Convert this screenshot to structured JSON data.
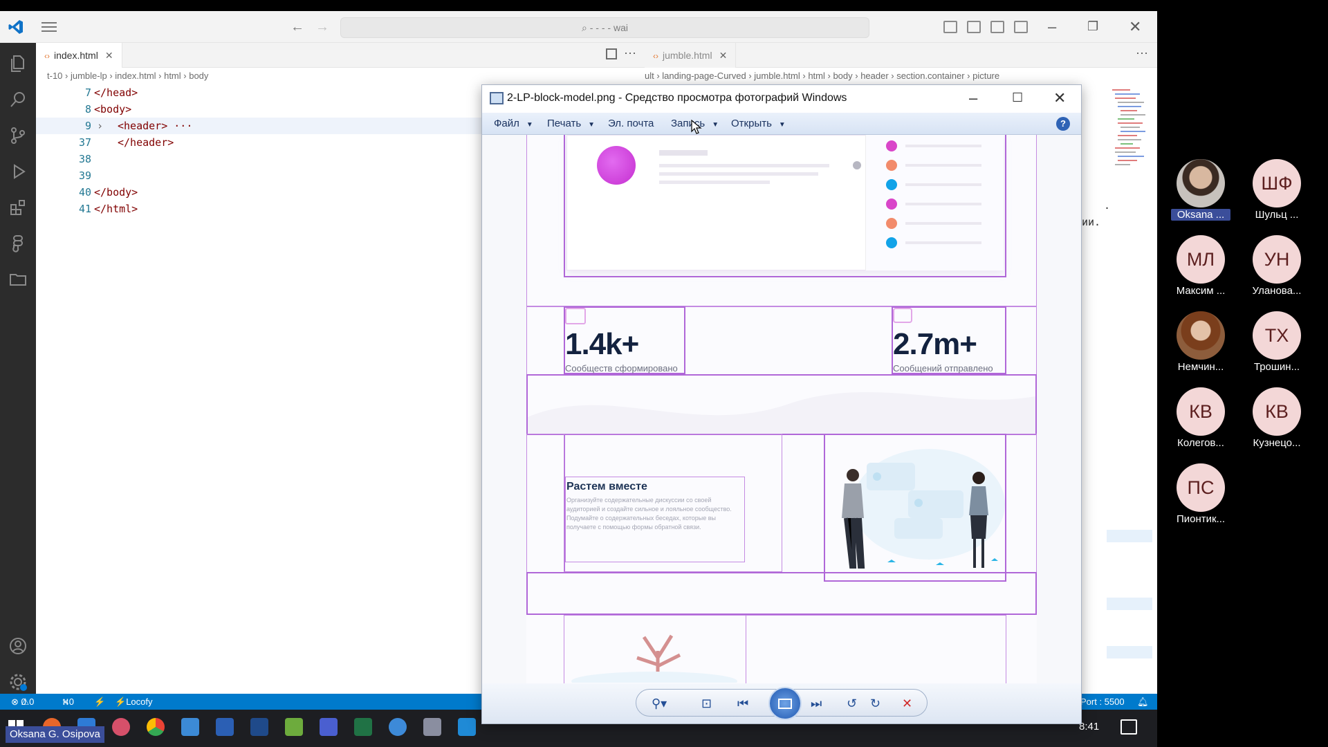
{
  "vscode": {
    "search_text": "- - - - wai",
    "left_tab": "index.html",
    "right_tab": "jumble.html",
    "left_breadcrumbs": [
      "t-10",
      "jumble-lp",
      "index.html",
      "html",
      "body"
    ],
    "right_breadcrumbs": [
      "ult",
      "landing-page-Curved",
      "jumble.html",
      "html",
      "body",
      "header",
      "section.container",
      "picture"
    ],
    "code_lines": [
      {
        "num": "7",
        "text": "</head>",
        "indent": 0
      },
      {
        "num": "8",
        "text": "<body>",
        "indent": 0
      },
      {
        "num": "9",
        "text": "<header> ···",
        "indent": 1
      },
      {
        "num": "37",
        "text": "</header>",
        "indent": 1
      },
      {
        "num": "38",
        "text": "",
        "indent": 0
      },
      {
        "num": "39",
        "text": "",
        "indent": 0
      },
      {
        "num": "40",
        "text": "</body>",
        "indent": 0
      },
      {
        "num": "41",
        "text": "</html>",
        "indent": 0
      }
    ],
    "right_peek_1": ".",
    "right_peek_2": "ии.",
    "status": {
      "errors": "0",
      "warnings": "0",
      "ports": "0",
      "locofy": "Locofy",
      "port": "Port : 5500"
    }
  },
  "viewer": {
    "title": "2-LP-block-model.png - Средство просмотра фотографий Windows",
    "menu": [
      "Файл",
      "Печать",
      "Эл. почта",
      "Запись",
      "Открыть"
    ],
    "image": {
      "stat1_value": "1.4k+",
      "stat1_label": "Сообществ сформировано",
      "stat2_value": "2.7m+",
      "stat2_label": "Сообщений отправлено",
      "feature_title": "Растем вместе",
      "feature_text": "Организуйте содержательные дискуссии со своей аудиторией и создайте сильное и лояльное сообщество. Подумайте о содержательных беседах, которые вы получаете с помощью формы обратной связи."
    },
    "colors": {
      "dots": [
        "#d946c9",
        "#f28b6b",
        "#12a3e8",
        "#d946c9",
        "#f28b6b",
        "#12a3e8"
      ]
    }
  },
  "taskbar": {
    "time": "8:41",
    "presenter": "Oksana G. Osipova"
  },
  "participants": [
    {
      "initials": "",
      "name": "Oksana ...",
      "selected": true
    },
    {
      "initials": "ШФ",
      "name": "Шульц ..."
    },
    {
      "initials": "МЛ",
      "name": "Максим ..."
    },
    {
      "initials": "УН",
      "name": "Уланова..."
    },
    {
      "initials": "",
      "name": "Немчин..."
    },
    {
      "initials": "ТХ",
      "name": "Трошин..."
    },
    {
      "initials": "КВ",
      "name": "Колегов..."
    },
    {
      "initials": "КВ",
      "name": "Кузнецо..."
    },
    {
      "initials": "ПС",
      "name": "Пионтик..."
    }
  ]
}
